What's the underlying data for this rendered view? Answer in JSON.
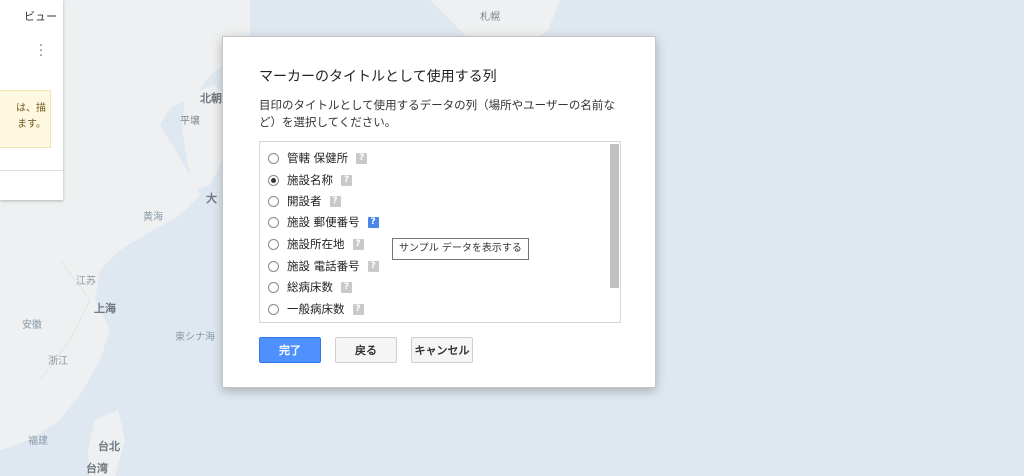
{
  "map": {
    "labels": [
      "札幌",
      "北朝",
      "平壌",
      "大",
      "上海",
      "江苏",
      "安徽",
      "東シナ海",
      "台北",
      "台湾",
      "浙江",
      "福建",
      "黄海"
    ]
  },
  "left_panel": {
    "title": "ビュー",
    "warning_line1": "は、描",
    "warning_line2": "ます。"
  },
  "dialog": {
    "title": "マーカーのタイトルとして使用する列",
    "description": "目印のタイトルとして使用するデータの列（場所やユーザーの名前など）を選択してください。",
    "options": [
      {
        "label": "管轄 保健所",
        "selected": false
      },
      {
        "label": "施設名称",
        "selected": true
      },
      {
        "label": "開設者",
        "selected": false
      },
      {
        "label": "施設 郵便番号",
        "selected": false
      },
      {
        "label": "施設所在地",
        "selected": false
      },
      {
        "label": "施設 電話番号",
        "selected": false
      },
      {
        "label": "総病床数",
        "selected": false
      },
      {
        "label": "一般病床数",
        "selected": false
      }
    ],
    "help_glyph": "?",
    "tooltip": "サンプル データを表示する",
    "buttons": {
      "done": "完了",
      "back": "戻る",
      "cancel": "キャンセル"
    }
  }
}
